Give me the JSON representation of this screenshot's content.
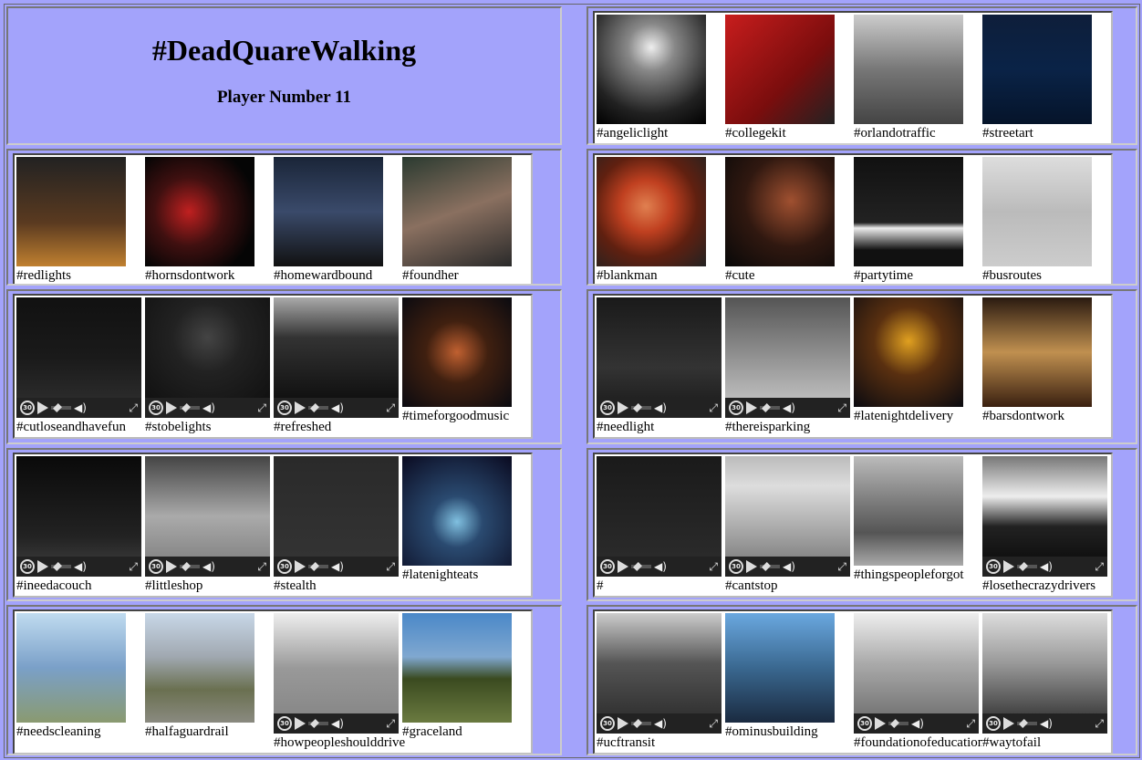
{
  "header": {
    "title": "#DeadQuareWalking",
    "subtitle": "Player Number 11"
  },
  "rows": [
    {
      "right": [
        {
          "tag": "#angeliclight",
          "video": false,
          "style": "p1"
        },
        {
          "tag": "#collegekit",
          "video": false,
          "style": "p2"
        },
        {
          "tag": "#orlandotraffic",
          "video": false,
          "style": "p3"
        },
        {
          "tag": "#streetart",
          "video": false,
          "style": "p4"
        }
      ]
    },
    {
      "left": [
        {
          "tag": "#redlights",
          "video": false,
          "style": "p5"
        },
        {
          "tag": "#hornsdontwork",
          "video": false,
          "style": "p6"
        },
        {
          "tag": "#homewardbound",
          "video": false,
          "style": "p7"
        },
        {
          "tag": "#foundher",
          "video": false,
          "style": "p8"
        }
      ],
      "right": [
        {
          "tag": "#blankman",
          "video": false,
          "style": "p9"
        },
        {
          "tag": "#cute",
          "video": false,
          "style": "p10"
        },
        {
          "tag": "#partytime",
          "video": false,
          "style": "p11"
        },
        {
          "tag": "#busroutes",
          "video": false,
          "style": "p12"
        }
      ]
    },
    {
      "left": [
        {
          "tag": "#cutloseandhavefun",
          "video": true,
          "style": "v1"
        },
        {
          "tag": "#stobelights",
          "video": true,
          "style": "v2"
        },
        {
          "tag": "#refreshed",
          "video": true,
          "style": "v3"
        },
        {
          "tag": "#timeforgoodmusic",
          "video": false,
          "style": "p13"
        }
      ],
      "right": [
        {
          "tag": "#needlight",
          "video": true,
          "style": "v4"
        },
        {
          "tag": "#thereisparking",
          "video": true,
          "style": "v5"
        },
        {
          "tag": "#latenightdelivery",
          "video": false,
          "style": "p14"
        },
        {
          "tag": "#barsdontwork",
          "video": false,
          "style": "p15"
        }
      ]
    },
    {
      "left": [
        {
          "tag": "#ineedacouch",
          "video": true,
          "style": "v6"
        },
        {
          "tag": "#littleshop",
          "video": true,
          "style": "v7"
        },
        {
          "tag": "#stealth",
          "video": true,
          "style": "v8"
        },
        {
          "tag": "#latenighteats",
          "video": false,
          "style": "p16"
        }
      ],
      "right": [
        {
          "tag": "#",
          "video": true,
          "style": "v9"
        },
        {
          "tag": "#cantstop",
          "video": true,
          "style": "v10"
        },
        {
          "tag": "#thingspeopleforgot",
          "video": false,
          "style": "p17"
        },
        {
          "tag": "#losethecrazydrivers",
          "video": true,
          "style": "v11"
        }
      ]
    },
    {
      "left": [
        {
          "tag": "#needscleaning",
          "video": false,
          "style": "p18"
        },
        {
          "tag": "#halfaguardrail",
          "video": false,
          "style": "p19"
        },
        {
          "tag": "#howpeopleshoulddrive",
          "video": true,
          "style": "v12"
        },
        {
          "tag": "#graceland",
          "video": false,
          "style": "p20"
        }
      ],
      "right": [
        {
          "tag": "#ucftransit",
          "video": true,
          "style": "v13"
        },
        {
          "tag": "#ominusbuilding",
          "video": false,
          "style": "p21"
        },
        {
          "tag": "#foundationofeducation",
          "video": true,
          "style": "v14"
        },
        {
          "tag": "#waytofail",
          "video": true,
          "style": "v15"
        }
      ]
    }
  ],
  "video_controls": {
    "replay_label": "30",
    "volume_icon": "volume-icon",
    "fullscreen_icon": "fullscreen-icon"
  }
}
